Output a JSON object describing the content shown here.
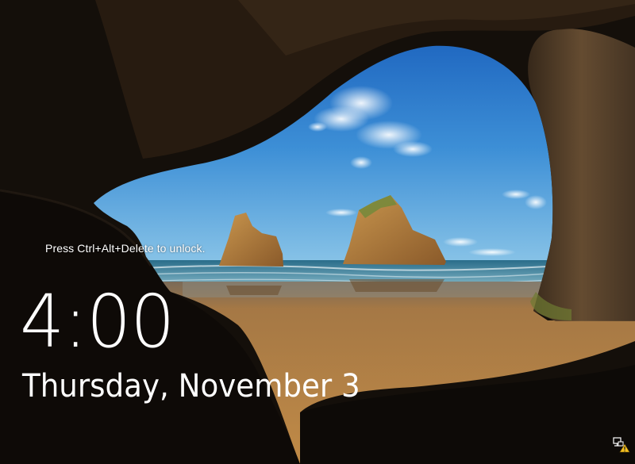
{
  "lock_screen": {
    "unlock_hint": "Press Ctrl+Alt+Delete to unlock.",
    "time": "4:00",
    "date": "Thursday, November 3"
  },
  "status_icons": {
    "network": "network-warning-icon"
  },
  "colors": {
    "text": "#ffffff",
    "sky": "#2b7fd0",
    "sand": "#b3803f",
    "cave": "#1c1510",
    "warning": "#f4c020"
  }
}
